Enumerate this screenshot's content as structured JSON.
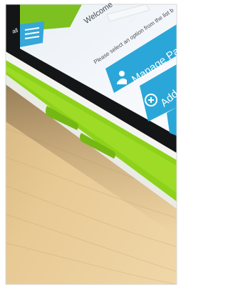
{
  "photo": {
    "subject": "tablet",
    "table_color": "#e6c995",
    "case_color": "#8ed11a",
    "screen_bg": "#f1f3f8",
    "accent": "#2aa7d8"
  },
  "app": {
    "header_title": "Welcome",
    "header_field": "",
    "instruction": "Please select an option from the list b",
    "status_text": "all",
    "menu_icon": "hamburger-icon",
    "buttons": [
      {
        "label": "Manage Patients",
        "icon": "person-icon"
      },
      {
        "label": "Add Patient",
        "icon": "plus-circle-icon"
      },
      {
        "label": "",
        "icon": ""
      }
    ]
  }
}
